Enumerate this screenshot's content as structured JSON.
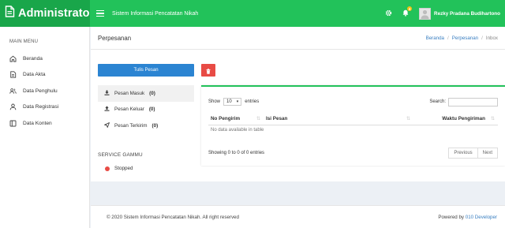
{
  "brand": {
    "title": "Administrator",
    "icon": "document-icon"
  },
  "topbar": {
    "app_title": "Sistem Informasi Pencatatan Nikah",
    "notification_count": "4",
    "user_name": "Rezky Pradana Budihartono"
  },
  "sidebar": {
    "header": "MAIN MENU",
    "items": [
      {
        "label": "Beranda",
        "icon": "home-icon"
      },
      {
        "label": "Data Akta",
        "icon": "file-icon"
      },
      {
        "label": "Data Penghulu",
        "icon": "users-icon"
      },
      {
        "label": "Data Registrasi",
        "icon": "user-icon"
      },
      {
        "label": "Data Konten",
        "icon": "window-icon"
      }
    ]
  },
  "page": {
    "title": "Perpesanan",
    "breadcrumb": [
      "Beranda",
      "Perpesanan",
      "Inbox"
    ]
  },
  "actions": {
    "compose_label": "Tulis Pesan"
  },
  "folders": [
    {
      "label": "Pesan Masuk",
      "count": "(0)"
    },
    {
      "label": "Pesan Keluar",
      "count": "(0)"
    },
    {
      "label": "Pesan Terkirim",
      "count": "(0)"
    }
  ],
  "service": {
    "title": "SERVICE GAMMU",
    "status": "Stopped",
    "status_color": "#e84b45"
  },
  "datatable": {
    "show_label": "Show",
    "page_length": "10",
    "entries_label": "entries",
    "search_label": "Search:",
    "search_value": "",
    "columns": [
      "No Pengirim",
      "Isi Pesan",
      "Waktu Pengiriman"
    ],
    "empty_message": "No data available in table",
    "info": "Showing 0 to 0 of 0 entries",
    "prev_label": "Previous",
    "next_label": "Next"
  },
  "footer": {
    "copyright": "© 2020 Sistem Informasi Pencatatan Nikah. All right reserved",
    "powered_prefix": "Powered by",
    "powered_link": "010 Developer"
  },
  "colors": {
    "primary": "#22c25a",
    "brand_dark": "#19a64a",
    "blue": "#2b84d2",
    "danger": "#e84b45"
  }
}
